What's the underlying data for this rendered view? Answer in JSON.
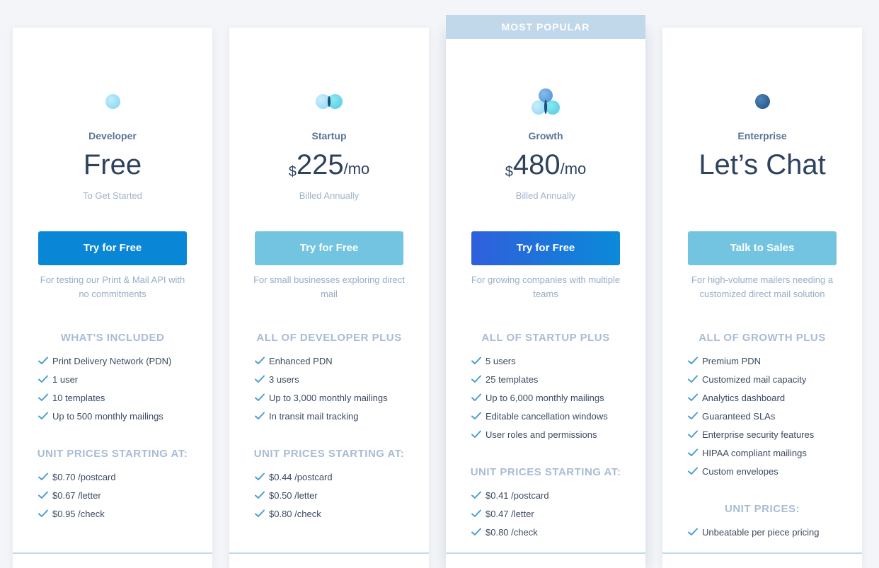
{
  "banner": "MOST POPULAR",
  "plans": [
    {
      "name": "Developer",
      "price_main": "Free",
      "currency": "",
      "price_suffix": "",
      "billing": "To Get Started",
      "cta": "Try for Free",
      "description": "For testing our Print & Mail API with no commitments",
      "section1_title": "WHAT'S INCLUDED",
      "features": [
        "Print Delivery Network (PDN)",
        "1 user",
        "10 templates",
        "Up to 500 monthly mailings"
      ],
      "section2_title": "UNIT PRICES STARTING AT:",
      "unit_prices": [
        "$0.70 /postcard",
        "$0.67 /letter",
        "$0.95 /check"
      ]
    },
    {
      "name": "Startup",
      "price_main": "225",
      "currency": "$",
      "price_suffix": "/mo",
      "billing": "Billed Annually",
      "cta": "Try for Free",
      "description": "For small businesses exploring direct mail",
      "section1_title": "ALL OF DEVELOPER PLUS",
      "features": [
        "Enhanced PDN",
        "3 users",
        "Up to 3,000 monthly mailings",
        "In transit mail tracking"
      ],
      "section2_title": "UNIT PRICES STARTING AT:",
      "unit_prices": [
        "$0.44 /postcard",
        "$0.50 /letter",
        "$0.80 /check"
      ]
    },
    {
      "name": "Growth",
      "price_main": "480",
      "currency": "$",
      "price_suffix": "/mo",
      "billing": "Billed Annually",
      "cta": "Try for Free",
      "description": "For growing companies with multiple teams",
      "section1_title": "ALL OF STARTUP PLUS",
      "features": [
        "5 users",
        "25 templates",
        "Up to 6,000 monthly mailings",
        "Editable cancellation windows",
        "User roles and permissions"
      ],
      "section2_title": "UNIT PRICES STARTING AT:",
      "unit_prices": [
        "$0.41 /postcard",
        "$0.47 /letter",
        "$0.80 /check"
      ]
    },
    {
      "name": "Enterprise",
      "price_main": "Let’s Chat",
      "currency": "",
      "price_suffix": "",
      "billing": "",
      "cta": "Talk to Sales",
      "description": "For high-volume mailers needing a customized direct mail solution",
      "section1_title": "ALL OF GROWTH PLUS",
      "features": [
        "Premium PDN",
        "Customized mail capacity",
        "Analytics dashboard",
        "Guaranteed SLAs",
        "Enterprise security features",
        "HIPAA compliant mailings",
        "Custom envelopes"
      ],
      "section2_title": "UNIT PRICES:",
      "unit_prices": [
        "Unbeatable per piece pricing"
      ]
    }
  ],
  "colors": {
    "developer_cta": "#0a86d6",
    "startup_cta": "#72c4e0",
    "growth_cta_start": "#2f5fdc",
    "growth_cta_end": "#0b8ad8",
    "enterprise_cta": "#72c4e0",
    "check": "#4a9fd0"
  },
  "icons": {
    "developer": "single-circle-icon",
    "startup": "two-circles-icon",
    "growth": "three-circles-icon",
    "enterprise": "dark-circle-icon",
    "feature_bullet": "check-icon"
  }
}
